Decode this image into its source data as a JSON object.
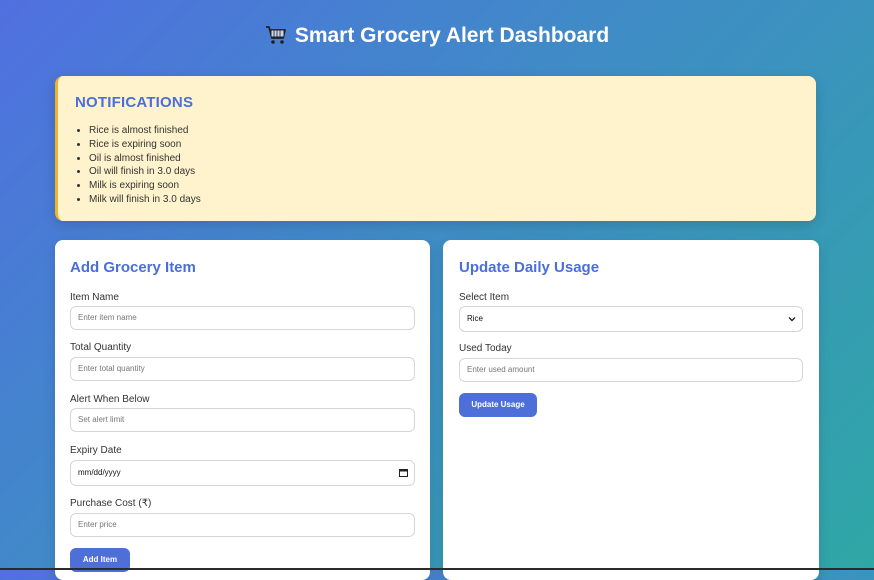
{
  "header": {
    "title": "Smart Grocery Alert Dashboard"
  },
  "notifications": {
    "title": "NOTIFICATIONS",
    "items": [
      "Rice is almost finished",
      "Rice is expiring soon",
      "Oil is almost finished",
      "Oil will finish in 3.0 days",
      "Milk is expiring soon",
      "Milk will finish in 3.0 days"
    ]
  },
  "add_item": {
    "title": "Add Grocery Item",
    "item_name_label": "Item Name",
    "item_name_placeholder": "Enter item name",
    "total_quantity_label": "Total Quantity",
    "total_quantity_placeholder": "Enter total quantity",
    "alert_label": "Alert When Below",
    "alert_placeholder": "Set alert limit",
    "expiry_label": "Expiry Date",
    "expiry_placeholder": "mm/dd/yyyy",
    "cost_label": "Purchase Cost (₹)",
    "cost_placeholder": "Enter price",
    "button": "Add Item"
  },
  "usage": {
    "title": "Update Daily Usage",
    "select_label": "Select Item",
    "selected_item": "Rice",
    "used_label": "Used Today",
    "used_placeholder": "Enter used amount",
    "button": "Update Usage"
  },
  "colors": {
    "accent": "#4a6edb",
    "notif_bg": "#fff3cd",
    "button": "#4f6fd8"
  }
}
